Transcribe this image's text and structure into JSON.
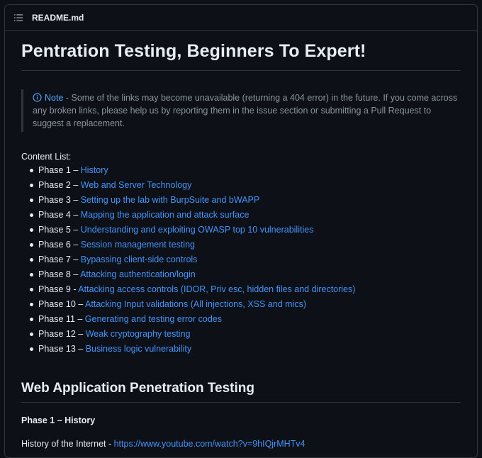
{
  "header": {
    "filename": "README.md"
  },
  "title": "Pentration Testing, Beginners To Expert!",
  "note": {
    "label": "Note",
    "text": " - Some of the links may become unavailable (returning a 404 error) in the future. If you come across any broken links, please help us by reporting them in the issue section or submitting a Pull Request to suggest a replacement."
  },
  "content_list_label": "Content List:",
  "phases": [
    {
      "prefix": "Phase 1 – ",
      "link": "History"
    },
    {
      "prefix": "Phase 2 – ",
      "link": "Web and Server Technology"
    },
    {
      "prefix": "Phase 3 – ",
      "link": "Setting up the lab with BurpSuite and bWAPP"
    },
    {
      "prefix": "Phase 4 – ",
      "link": "Mapping the application and attack surface"
    },
    {
      "prefix": "Phase 5 – ",
      "link": "Understanding and exploiting OWASP top 10 vulnerabilities"
    },
    {
      "prefix": "Phase 6 – ",
      "link": "Session management testing"
    },
    {
      "prefix": "Phase 7 – ",
      "link": "Bypassing client-side controls"
    },
    {
      "prefix": "Phase 8 – ",
      "link": "Attacking authentication/login"
    },
    {
      "prefix": "Phase 9 - ",
      "link": "Attacking access controls (IDOR, Priv esc, hidden files and directories)"
    },
    {
      "prefix": "Phase 10 – ",
      "link": "Attacking Input validations (All injections, XSS and mics)"
    },
    {
      "prefix": "Phase 11 – ",
      "link": "Generating and testing error codes"
    },
    {
      "prefix": "Phase 12 – ",
      "link": "Weak cryptography testing"
    },
    {
      "prefix": "Phase 13 – ",
      "link": "Business logic vulnerability"
    }
  ],
  "section2": {
    "title": "Web Application Penetration Testing",
    "phase_heading": "Phase 1 – History",
    "history_text": "History of the Internet - ",
    "history_link": "https://www.youtube.com/watch?v=9hIQjrMHTv4"
  }
}
